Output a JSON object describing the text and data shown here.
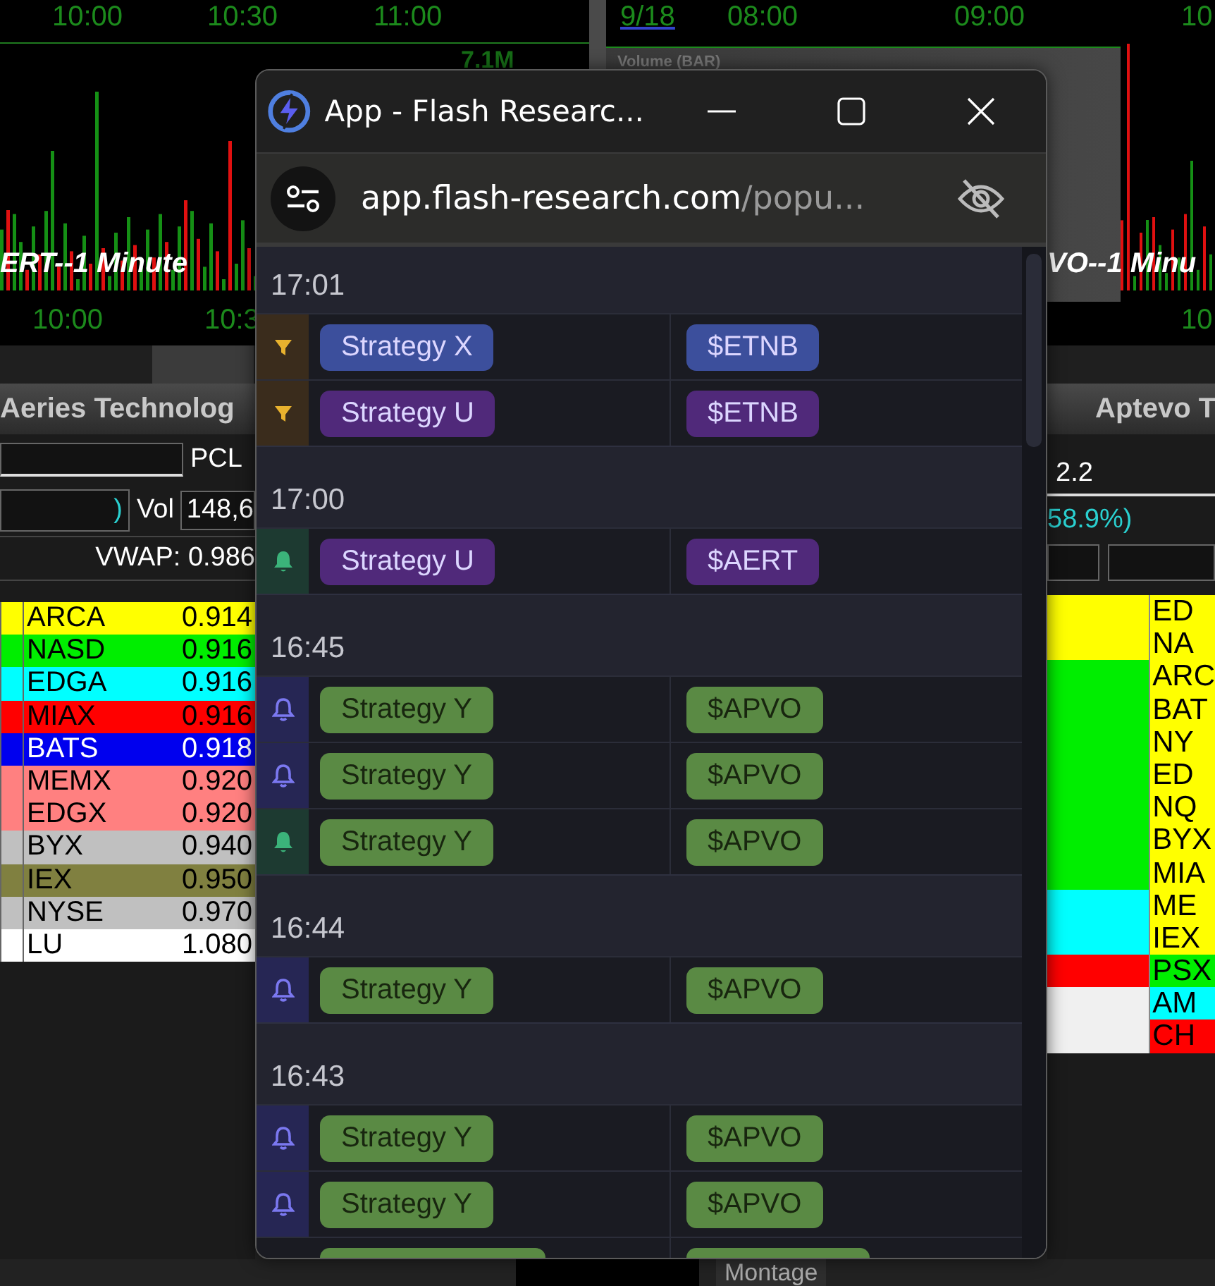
{
  "left_chart": {
    "top_axis": [
      "10:00",
      "10:30",
      "11:00"
    ],
    "scale_label": "7.1M",
    "series_label": "ERT--1 Minute",
    "bottom_axis": [
      "10:00",
      "10:3"
    ]
  },
  "right_chart": {
    "date": "9/18",
    "top_axis": [
      "08:00",
      "09:00",
      "10"
    ],
    "pane_label": "Volume (BAR)",
    "series_label": "VO--1 Minu",
    "bottom_axis": [
      "10"
    ]
  },
  "left_panel": {
    "title": "Aeries Technolog",
    "pcl_label": "PCL",
    "change": ")",
    "vol_label": "Vol",
    "vol_value": "148,6",
    "vwap": "VWAP: 0.986",
    "rows": [
      {
        "exchange": "ARCA",
        "price": "0.914",
        "color": "#ffff00"
      },
      {
        "exchange": "NASD",
        "price": "0.916",
        "color": "#00ee00"
      },
      {
        "exchange": "EDGA",
        "price": "0.916",
        "color": "#00ffff"
      },
      {
        "exchange": "MIAX",
        "price": "0.916",
        "color": "#ff0000"
      },
      {
        "exchange": "BATS",
        "price": "0.918",
        "color": "#0000ee"
      },
      {
        "exchange": "MEMX",
        "price": "0.920",
        "color": "#ff8080"
      },
      {
        "exchange": "EDGX",
        "price": "0.920",
        "color": "#ff8080"
      },
      {
        "exchange": "BYX",
        "price": "0.940",
        "color": "#c0c0c0"
      },
      {
        "exchange": "IEX",
        "price": "0.950",
        "color": "#808040"
      },
      {
        "exchange": "NYSE",
        "price": "0.970",
        "color": "#c0c0c0"
      },
      {
        "exchange": "LU",
        "price": "1.080",
        "color": "#ffffff"
      }
    ]
  },
  "right_panel": {
    "title": "Aptevo T",
    "value": "2.2",
    "change": "58.9%)",
    "bid_rows": [
      {
        "color": "#ffff00"
      },
      {
        "color": "#ffff00"
      },
      {
        "color": "#00ee00"
      },
      {
        "color": "#00ee00"
      },
      {
        "color": "#00ee00"
      },
      {
        "color": "#00ee00"
      },
      {
        "color": "#00ee00"
      },
      {
        "color": "#00ee00"
      },
      {
        "color": "#00ee00"
      },
      {
        "color": "#00ffff"
      },
      {
        "color": "#00ffff"
      },
      {
        "color": "#ff0000"
      },
      {
        "color": "#f0f0f0"
      },
      {
        "color": "#f0f0f0"
      }
    ],
    "ask_rows": [
      {
        "exchange": "ED",
        "color": "#ffff00"
      },
      {
        "exchange": "NA",
        "color": "#ffff00"
      },
      {
        "exchange": "ARC",
        "color": "#ffff00"
      },
      {
        "exchange": "BAT",
        "color": "#ffff00"
      },
      {
        "exchange": "NY",
        "color": "#ffff00"
      },
      {
        "exchange": "ED",
        "color": "#ffff00"
      },
      {
        "exchange": "NQ",
        "color": "#ffff00"
      },
      {
        "exchange": "BYX",
        "color": "#ffff00"
      },
      {
        "exchange": "MIA",
        "color": "#ffff00"
      },
      {
        "exchange": "ME",
        "color": "#ffff00"
      },
      {
        "exchange": "IEX",
        "color": "#ffff00"
      },
      {
        "exchange": "PSX",
        "color": "#00ee00"
      },
      {
        "exchange": "AM",
        "color": "#00ffff"
      },
      {
        "exchange": "CH",
        "color": "#ff0000"
      }
    ]
  },
  "bottom_bar": {
    "label": "Montage"
  },
  "popup": {
    "title": "App - Flash Researc...",
    "url_host": "app.flash-research.com",
    "url_path": "/popu...",
    "groups": [
      {
        "time": "17:01",
        "alerts": [
          {
            "kind": "filter",
            "strategy": {
              "label": "Strategy X",
              "color": "#3c4f9c"
            },
            "ticker": {
              "label": "$ETNB",
              "color": "#3c4f9c"
            }
          },
          {
            "kind": "filter",
            "strategy": {
              "label": "Strategy U",
              "color": "#50297a"
            },
            "ticker": {
              "label": "$ETNB",
              "color": "#50297a"
            }
          }
        ]
      },
      {
        "time": "17:00",
        "alerts": [
          {
            "kind": "bell-filled",
            "strategy": {
              "label": "Strategy U",
              "color": "#50297a"
            },
            "ticker": {
              "label": "$AERT",
              "color": "#50297a"
            }
          }
        ]
      },
      {
        "time": "16:45",
        "alerts": [
          {
            "kind": "bell",
            "strategy": {
              "label": "Strategy Y",
              "color": "#5a8a44"
            },
            "ticker": {
              "label": "$APVO",
              "color": "#5a8a44"
            }
          },
          {
            "kind": "bell",
            "strategy": {
              "label": "Strategy Y",
              "color": "#5a8a44"
            },
            "ticker": {
              "label": "$APVO",
              "color": "#5a8a44"
            }
          },
          {
            "kind": "bell-filled",
            "strategy": {
              "label": "Strategy Y",
              "color": "#5a8a44"
            },
            "ticker": {
              "label": "$APVO",
              "color": "#5a8a44"
            }
          }
        ]
      },
      {
        "time": "16:44",
        "alerts": [
          {
            "kind": "bell",
            "strategy": {
              "label": "Strategy Y",
              "color": "#5a8a44"
            },
            "ticker": {
              "label": "$APVO",
              "color": "#5a8a44"
            }
          }
        ]
      },
      {
        "time": "16:43",
        "alerts": [
          {
            "kind": "bell",
            "strategy": {
              "label": "Strategy Y",
              "color": "#5a8a44"
            },
            "ticker": {
              "label": "$APVO",
              "color": "#5a8a44"
            }
          },
          {
            "kind": "bell",
            "strategy": {
              "label": "Strategy Y",
              "color": "#5a8a44"
            },
            "ticker": {
              "label": "$APVO",
              "color": "#5a8a44"
            }
          }
        ]
      }
    ]
  }
}
